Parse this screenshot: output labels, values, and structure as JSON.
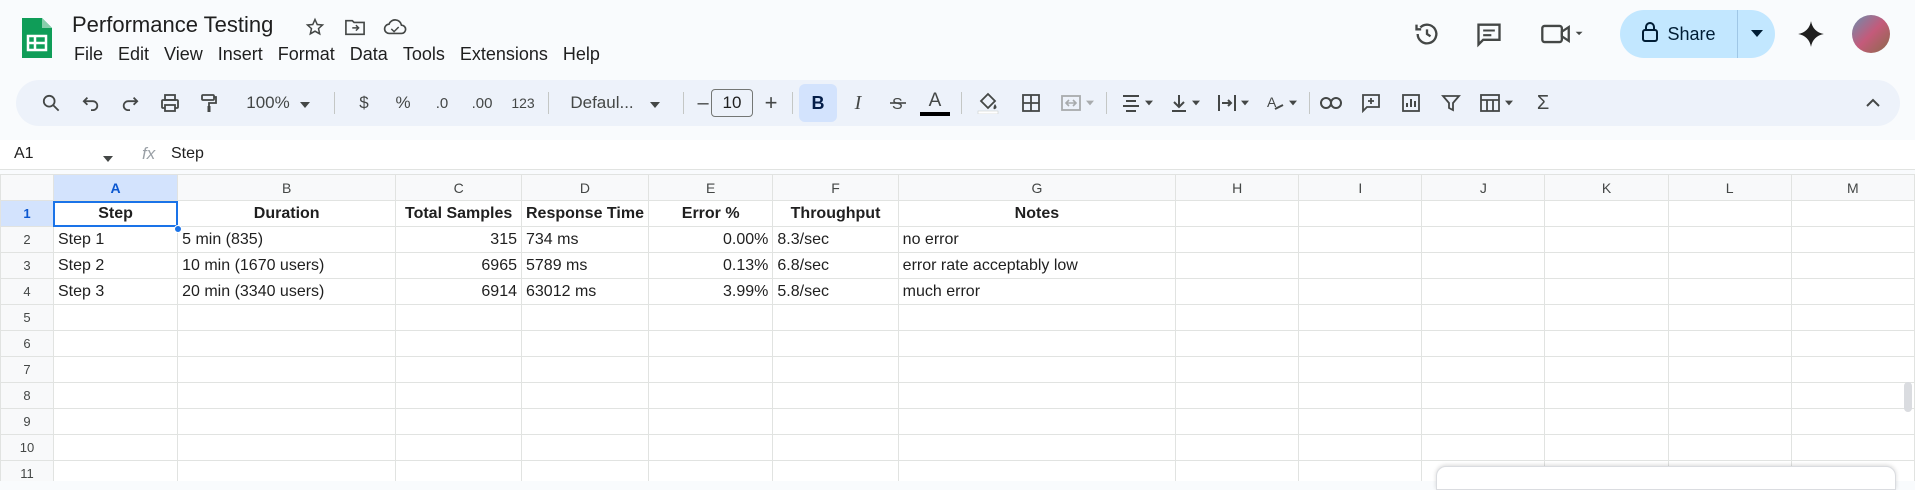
{
  "app": {
    "doc_title": "Performance Testing",
    "menus": [
      "File",
      "Edit",
      "View",
      "Insert",
      "Format",
      "Data",
      "Tools",
      "Extensions",
      "Help"
    ],
    "share_label": "Share"
  },
  "toolbar": {
    "zoom": "100%",
    "currency": "$",
    "percent": "%",
    "dec_less": ".0",
    "dec_more": ".00",
    "number_fmt": "123",
    "font": "Defaul...",
    "font_size": "10",
    "bold": "B",
    "italic": "I",
    "text_color": "A"
  },
  "formula_bar": {
    "name_box": "A1",
    "fx": "fx",
    "value": "Step"
  },
  "columns": [
    "A",
    "B",
    "C",
    "D",
    "E",
    "F",
    "G",
    "H",
    "I",
    "J",
    "K",
    "L",
    "M"
  ],
  "rows": [
    [
      "Step",
      "Duration",
      "Total Samples",
      "Response Time",
      "Error %",
      "Throughput",
      "Notes",
      "",
      "",
      "",
      "",
      "",
      ""
    ],
    [
      "Step 1",
      "5 min (835)",
      "315",
      "734 ms",
      "0.00%",
      "8.3/sec",
      "no error",
      "",
      "",
      "",
      "",
      "",
      ""
    ],
    [
      "Step 2",
      "10 min (1670 users)",
      "6965",
      "5789 ms",
      "0.13%",
      "6.8/sec",
      "error rate acceptably low",
      "",
      "",
      "",
      "",
      "",
      ""
    ],
    [
      "Step 3",
      "20 min (3340 users)",
      "6914",
      "63012 ms",
      "3.99%",
      "5.8/sec",
      "much error",
      "",
      "",
      "",
      "",
      "",
      ""
    ],
    [
      "",
      "",
      "",
      "",
      "",
      "",
      "",
      "",
      "",
      "",
      "",
      "",
      ""
    ],
    [
      "",
      "",
      "",
      "",
      "",
      "",
      "",
      "",
      "",
      "",
      "",
      "",
      ""
    ],
    [
      "",
      "",
      "",
      "",
      "",
      "",
      "",
      "",
      "",
      "",
      "",
      "",
      ""
    ],
    [
      "",
      "",
      "",
      "",
      "",
      "",
      "",
      "",
      "",
      "",
      "",
      "",
      ""
    ],
    [
      "",
      "",
      "",
      "",
      "",
      "",
      "",
      "",
      "",
      "",
      "",
      "",
      ""
    ],
    [
      "",
      "",
      "",
      "",
      "",
      "",
      "",
      "",
      "",
      "",
      "",
      "",
      ""
    ],
    [
      "",
      "",
      "",
      "",
      "",
      "",
      "",
      "",
      "",
      "",
      "",
      "",
      ""
    ]
  ],
  "row_numbers": [
    "1",
    "2",
    "3",
    "4",
    "5",
    "6",
    "7",
    "8",
    "9",
    "10",
    "11"
  ],
  "colors": {
    "accent": "#1a73e8",
    "share_bg": "#c2e7ff",
    "toolbar_bg": "#edf2fa",
    "sheets_green": "#0f9d58"
  }
}
